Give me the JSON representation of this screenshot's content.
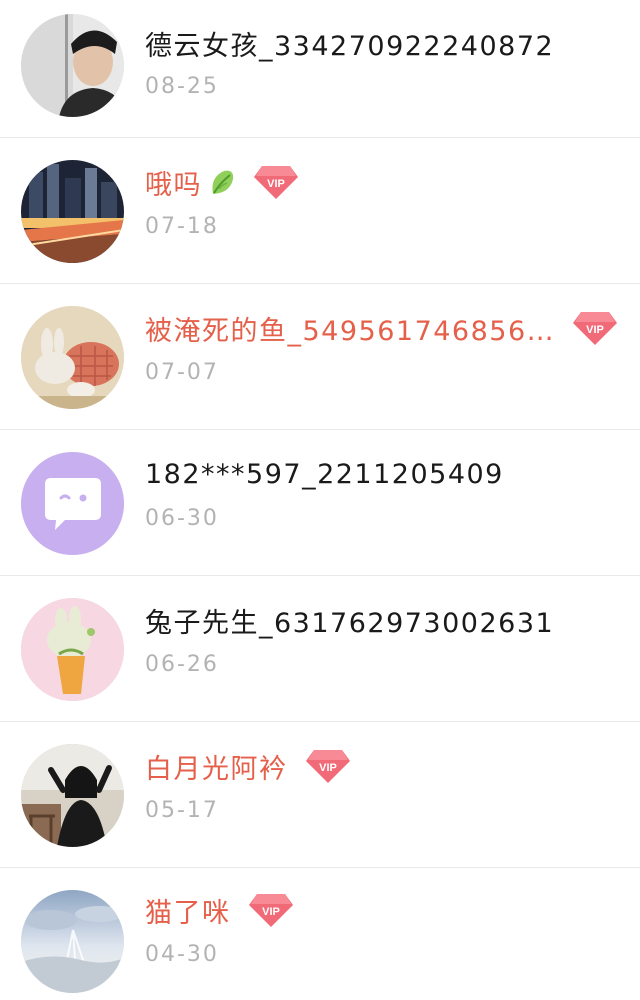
{
  "conversations": [
    {
      "name": "德云女孩_334270922240872",
      "date": "08-25",
      "vip": false,
      "avatar": "portrait-photo"
    },
    {
      "name": "哦吗",
      "date": "07-18",
      "vip": true,
      "leaf": true,
      "avatar": "city-night-photo"
    },
    {
      "name": "被淹死的鱼_549561746856…",
      "date": "07-07",
      "vip": true,
      "avatar": "bunny-illustration"
    },
    {
      "name": "182***597_2211205409",
      "date": "06-30",
      "vip": false,
      "avatar": "chat-bubble-default"
    },
    {
      "name": "兔子先生_631762973002631",
      "date": "06-26",
      "vip": false,
      "avatar": "rabbit-illustration"
    },
    {
      "name": "白月光阿衿",
      "date": "05-17",
      "vip": true,
      "avatar": "girl-photo"
    },
    {
      "name": "猫了咪",
      "date": "04-30",
      "vip": true,
      "avatar": "sky-photo"
    }
  ],
  "badges": {
    "vip_label": "VIP"
  },
  "colors": {
    "vip_name": "#e5604a",
    "normal_name": "#1a1a1a",
    "date": "#b3b3b3",
    "vip_badge": "#f06a78",
    "default_avatar_bg": "#c8b0f0"
  }
}
